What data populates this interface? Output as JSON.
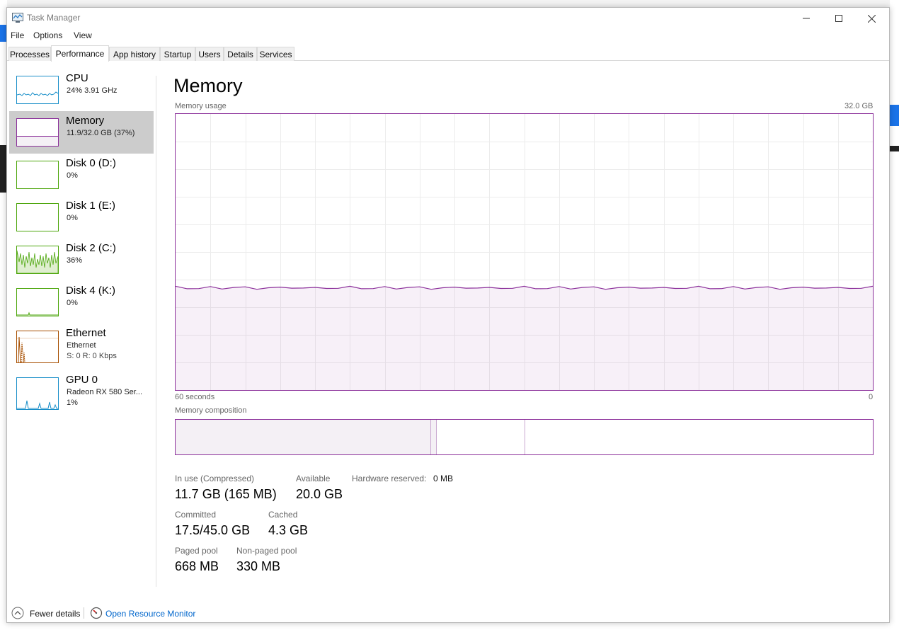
{
  "window": {
    "title": "Task Manager",
    "minimize_icon": "minimize-icon",
    "maximize_icon": "maximize-icon",
    "close_icon": "close-icon"
  },
  "menu": {
    "file": "File",
    "options": "Options",
    "view": "View"
  },
  "tabs": [
    {
      "label": "Processes"
    },
    {
      "label": "Performance",
      "active": true
    },
    {
      "label": "App history"
    },
    {
      "label": "Startup"
    },
    {
      "label": "Users"
    },
    {
      "label": "Details"
    },
    {
      "label": "Services"
    }
  ],
  "sidebar": {
    "items": [
      {
        "title": "CPU",
        "sub": "24%  3.91 GHz",
        "color": "#1a8fc9"
      },
      {
        "title": "Memory",
        "sub": "11.9/32.0 GB (37%)",
        "color": "#8b2f9a",
        "selected": true
      },
      {
        "title": "Disk 0 (D:)",
        "sub": "0%",
        "color": "#4da60c"
      },
      {
        "title": "Disk 1 (E:)",
        "sub": "0%",
        "color": "#4da60c"
      },
      {
        "title": "Disk 2 (C:)",
        "sub": "36%",
        "color": "#4da60c"
      },
      {
        "title": "Disk 4 (K:)",
        "sub": "0%",
        "color": "#4da60c"
      },
      {
        "title": "Ethernet",
        "sub": "Ethernet",
        "sub2": "S: 0 R: 0 Kbps",
        "color": "#a74f01"
      },
      {
        "title": "GPU 0",
        "sub": "Radeon RX 580 Ser...",
        "sub2": "1%",
        "color": "#1a8fc9"
      }
    ]
  },
  "main": {
    "title": "Memory",
    "usage_label": "Memory usage",
    "usage_max": "32.0 GB",
    "time_left": "60 seconds",
    "time_right": "0",
    "composition_label": "Memory composition",
    "usage_fraction": 0.37,
    "composition_fractions": {
      "in_use": 0.366,
      "modified": 0.008,
      "standby": 0.127
    },
    "stats": {
      "in_use_label": "In use (Compressed)",
      "in_use_value": "11.7 GB (165 MB)",
      "available_label": "Available",
      "available_value": "20.0 GB",
      "hw_reserved_label": "Hardware reserved:",
      "hw_reserved_value": "0 MB",
      "committed_label": "Committed",
      "committed_value": "17.5/45.0 GB",
      "cached_label": "Cached",
      "cached_value": "4.3 GB",
      "paged_label": "Paged pool",
      "paged_value": "668 MB",
      "nonpaged_label": "Non-paged pool",
      "nonpaged_value": "330 MB"
    }
  },
  "footer": {
    "fewer_details": "Fewer details",
    "open_monitor": "Open Resource Monitor",
    "link_color": "#0066cc"
  }
}
